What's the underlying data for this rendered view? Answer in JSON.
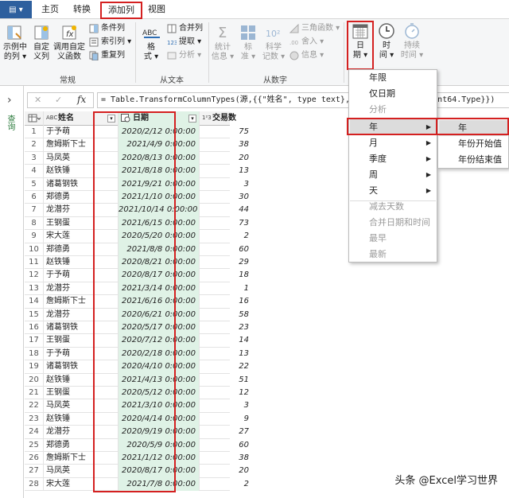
{
  "tabs": {
    "file": "▤ ▾",
    "home": "主页",
    "transform": "转换",
    "add_column": "添加列",
    "view": "视图"
  },
  "ribbon": {
    "example_col": [
      "示例中",
      "的列 ▾"
    ],
    "custom_col": [
      "自定",
      "义列"
    ],
    "invoke_custom": [
      "调用自定",
      "义函数"
    ],
    "conditional_col": "条件列",
    "index_col": "索引列 ▾",
    "duplicate_col": "重复列",
    "group_general": "常规",
    "format": [
      "格",
      "式 ▾"
    ],
    "merge_cols": "合并列",
    "extract": "提取 ▾",
    "parse": "分析 ▾",
    "group_text": "从文本",
    "statistics": [
      "统计",
      "信息 ▾"
    ],
    "standard": [
      "标",
      "准 ▾"
    ],
    "scientific": [
      "科学",
      "记数 ▾"
    ],
    "trig": "三角函数 ▾",
    "rounding": "舍入 ▾",
    "information": "信息 ▾",
    "group_number": "从数字",
    "date": [
      "日",
      "期 ▾"
    ],
    "time": [
      "时",
      "间 ▾"
    ],
    "duration": [
      "持续",
      "时间 ▾"
    ],
    "sci_icon": "10²",
    "fmt_icon": "ABC"
  },
  "formula": {
    "cancel": "✕",
    "confirm": "✓",
    "fx": "fx",
    "expression": "= Table.TransformColumnTypes(源,{{\"姓名\", type text}, {\"日期\"                             \"交易数\", Int64.Type}})"
  },
  "left_nav": {
    "toggle": "›",
    "label": "查询"
  },
  "table": {
    "headers": {
      "name": "姓名",
      "date": "日期",
      "count": "交易数",
      "name_type": "ABC",
      "count_type": "1²3"
    },
    "rows": [
      {
        "i": "1",
        "name": "于予萌",
        "date": "2020/2/12 0:00:00",
        "count": "75"
      },
      {
        "i": "2",
        "name": "詹姆斯下士",
        "date": "2021/4/9 0:00:00",
        "count": "38"
      },
      {
        "i": "3",
        "name": "马凤英",
        "date": "2020/8/13 0:00:00",
        "count": "20"
      },
      {
        "i": "4",
        "name": "赵铁锤",
        "date": "2021/8/18 0:00:00",
        "count": "13"
      },
      {
        "i": "5",
        "name": "诸葛钢铁",
        "date": "2021/9/21 0:00:00",
        "count": "3"
      },
      {
        "i": "6",
        "name": "郑德勇",
        "date": "2021/1/10 0:00:00",
        "count": "30"
      },
      {
        "i": "7",
        "name": "龙潜芬",
        "date": "2021/10/14 0:00:00",
        "count": "44"
      },
      {
        "i": "8",
        "name": "王钢蛋",
        "date": "2021/6/15 0:00:00",
        "count": "73"
      },
      {
        "i": "9",
        "name": "宋大莲",
        "date": "2020/5/20 0:00:00",
        "count": "2"
      },
      {
        "i": "10",
        "name": "郑德勇",
        "date": "2021/8/8 0:00:00",
        "count": "60"
      },
      {
        "i": "11",
        "name": "赵铁锤",
        "date": "2020/8/21 0:00:00",
        "count": "29"
      },
      {
        "i": "12",
        "name": "于予萌",
        "date": "2020/8/17 0:00:00",
        "count": "18"
      },
      {
        "i": "13",
        "name": "龙潜芬",
        "date": "2021/3/14 0:00:00",
        "count": "1"
      },
      {
        "i": "14",
        "name": "詹姆斯下士",
        "date": "2021/6/16 0:00:00",
        "count": "16"
      },
      {
        "i": "15",
        "name": "龙潜芬",
        "date": "2020/6/21 0:00:00",
        "count": "58"
      },
      {
        "i": "16",
        "name": "诸葛钢铁",
        "date": "2020/5/17 0:00:00",
        "count": "23"
      },
      {
        "i": "17",
        "name": "王钢蛋",
        "date": "2020/7/12 0:00:00",
        "count": "14"
      },
      {
        "i": "18",
        "name": "于予萌",
        "date": "2020/2/18 0:00:00",
        "count": "13"
      },
      {
        "i": "19",
        "name": "诸葛钢铁",
        "date": "2020/4/10 0:00:00",
        "count": "22"
      },
      {
        "i": "20",
        "name": "赵铁锤",
        "date": "2021/4/13 0:00:00",
        "count": "51"
      },
      {
        "i": "21",
        "name": "王钢蛋",
        "date": "2020/5/12 0:00:00",
        "count": "12"
      },
      {
        "i": "22",
        "name": "马凤英",
        "date": "2021/3/10 0:00:00",
        "count": "3"
      },
      {
        "i": "23",
        "name": "赵铁锤",
        "date": "2020/4/14 0:00:00",
        "count": "9"
      },
      {
        "i": "24",
        "name": "龙潜芬",
        "date": "2020/9/19 0:00:00",
        "count": "27"
      },
      {
        "i": "25",
        "name": "郑德勇",
        "date": "2020/5/9 0:00:00",
        "count": "60"
      },
      {
        "i": "26",
        "name": "詹姆斯下士",
        "date": "2021/1/12 0:00:00",
        "count": "38"
      },
      {
        "i": "27",
        "name": "马凤英",
        "date": "2020/8/17 0:00:00",
        "count": "20"
      },
      {
        "i": "28",
        "name": "宋大莲",
        "date": "2021/7/8 0:00:00",
        "count": "2"
      }
    ]
  },
  "date_menu": {
    "items": [
      "年限",
      "仅日期",
      "分析",
      "年",
      "月",
      "季度",
      "周",
      "天",
      "减去天数",
      "合并日期和时间",
      "最早",
      "最新"
    ]
  },
  "year_menu": {
    "items": [
      "年",
      "年份开始值",
      "年份结束值"
    ]
  },
  "watermark": "头条 @Excel学习世界",
  "colors": {
    "highlight_red": "#d42020",
    "date_col_bg": "#dff2e6",
    "ribbon_bg": "#f5f6f7"
  }
}
